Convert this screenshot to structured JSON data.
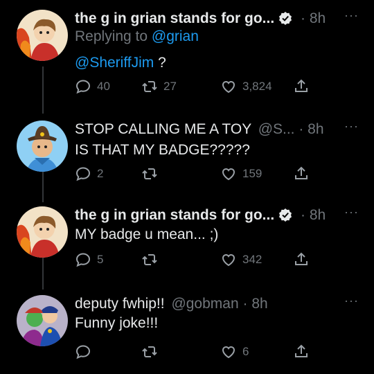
{
  "tweets": [
    {
      "name": "the g in grian stands for go...",
      "handle": "",
      "time": "· 8h",
      "verified": true,
      "replying_label": "Replying to",
      "replying_to": "@grian",
      "mention": "@SheriffJim",
      "text": " ?",
      "replies": "40",
      "retweets": "27",
      "likes": "3,824"
    },
    {
      "name": "STOP CALLING ME A TOY",
      "handle": "@S...",
      "time": "· 8h",
      "text": "IS THAT MY BADGE?????",
      "replies": "2",
      "retweets": "",
      "likes": "159"
    },
    {
      "name": "the g in grian stands for go...",
      "handle": "",
      "time": "· 8h",
      "verified": true,
      "text": "MY badge u mean... ;)",
      "replies": "5",
      "retweets": "",
      "likes": "342"
    },
    {
      "name": "deputy fwhip!!",
      "handle": "@gobman",
      "time": "· 8h",
      "text": "Funny joke!!!",
      "replies": "",
      "retweets": "",
      "likes": "6"
    }
  ],
  "more_label": "···",
  "colors": {
    "background": "#000000",
    "text": "#e7e9ea",
    "muted": "#71767b",
    "link": "#1d9bf0"
  }
}
